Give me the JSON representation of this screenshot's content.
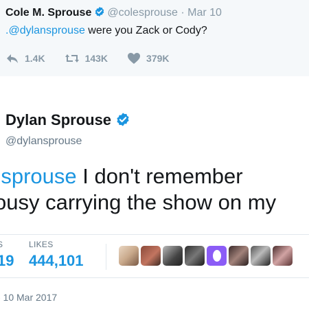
{
  "colors": {
    "twitter_blue": "#1b95e0",
    "like_purple": "#8b5cf6"
  },
  "quoted_tweet": {
    "name": "Cole M. Sprouse",
    "handle": "@colesprouse",
    "separator": "·",
    "date": "Mar 10",
    "mention": ".@dylansprouse",
    "text": " were you Zack or Cody?",
    "reply_icon": "reply-icon",
    "retweet_icon": "retweet-icon",
    "like_icon": "heart-icon",
    "replies": "1.4K",
    "retweets": "143K",
    "likes": "379K"
  },
  "main_tweet": {
    "name": "Dylan Sprouse",
    "handle": "@dylansprouse",
    "mention": "olesprouse",
    "text_line1": " I don't remember",
    "text_line2": "ousy carrying the show on my",
    "retweets_label": "S",
    "retweets_value": "19",
    "likes_label": "LIKES",
    "likes_value": "444,101",
    "timestamp": "- 10 Mar 2017"
  }
}
